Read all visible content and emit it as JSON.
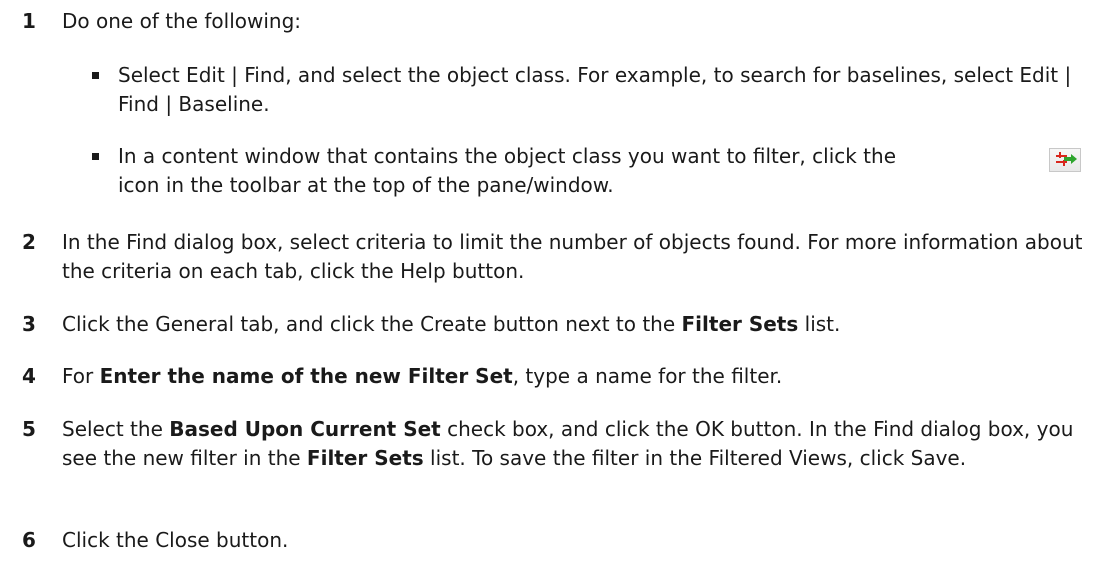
{
  "steps": [
    {
      "number": "1",
      "text": "Do one of the following:",
      "bullets": [
        "Select Edit | Find, and select the object class. For example, to search for baselines, select Edit | Find | Baseline.",
        {
          "before_icon": "In a content window that contains the object class you want to filter, click the",
          "icon": "filter-toolbar-icon",
          "after_icon": "icon in the toolbar at the top of the pane/window."
        }
      ]
    },
    {
      "number": "2",
      "text": "In the Find dialog box, select criteria to limit the number of objects found. For more information about the criteria on each tab, click the Help button."
    },
    {
      "number": "3",
      "parts": [
        "Click the General tab, and click the Create button next to the ",
        "Filter Sets",
        " list."
      ]
    },
    {
      "number": "4",
      "parts": [
        "For ",
        "Enter the name of the new Filter Set",
        ", type a name for the filter."
      ]
    },
    {
      "number": "5",
      "parts": [
        "Select the ",
        "Based Upon Current Set",
        " check box, and click the OK button. In the Find dialog box, you see the new filter in the ",
        "Filter Sets",
        " list. To save the filter in the Filtered Views, click Save."
      ]
    },
    {
      "number": "6",
      "text": "Click the Close button."
    }
  ],
  "colors": {
    "text": "#1a1a1a",
    "icon_red": "#d9261c",
    "icon_green": "#2ea52e"
  }
}
